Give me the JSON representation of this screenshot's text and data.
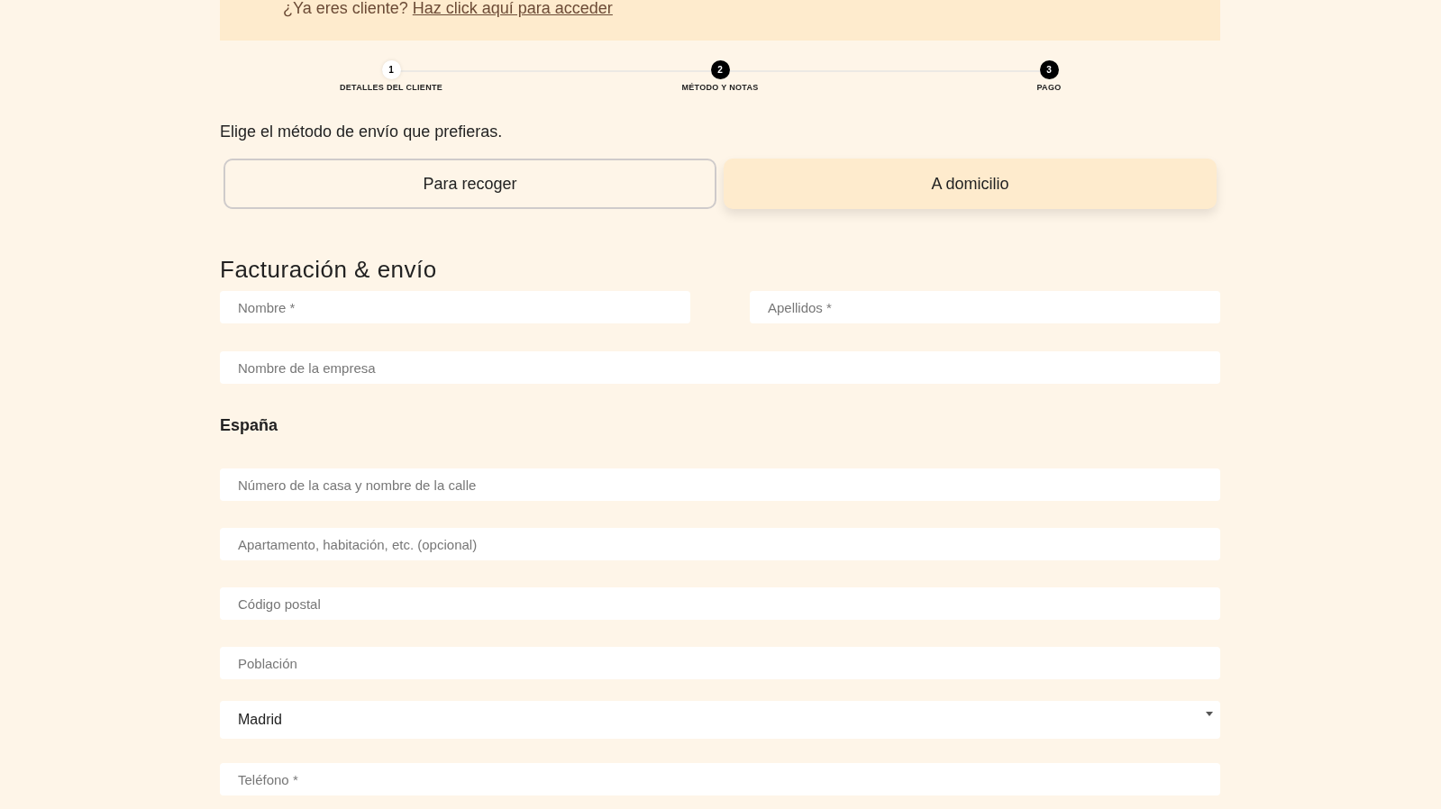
{
  "login_notice": {
    "text": "¿Ya eres cliente?",
    "link": "Haz click aquí para acceder"
  },
  "steps": [
    {
      "number": "1",
      "label": "DETALLES DEL CLIENTE",
      "selected": true
    },
    {
      "number": "2",
      "label": "MÉTODO Y NOTAS",
      "selected": false
    },
    {
      "number": "3",
      "label": "PAGO",
      "selected": false
    }
  ],
  "shipping_prompt": "Elige el método de envío que prefieras.",
  "shipping_options": [
    {
      "label": "Para recoger",
      "selected": false
    },
    {
      "label": "A domicilio",
      "selected": true
    }
  ],
  "section_title": "Facturación & envío",
  "name_fields": [
    {
      "placeholder": "Nombre *"
    },
    {
      "placeholder": "Apellidos *"
    }
  ],
  "company_field": {
    "placeholder": "Nombre de la empresa"
  },
  "country": "España",
  "address_fields": [
    {
      "placeholder": "Número de la casa y nombre de la calle"
    },
    {
      "placeholder": "Apartamento, habitación, etc. (opcional)"
    },
    {
      "placeholder": "Código postal"
    },
    {
      "placeholder": "Población"
    }
  ],
  "province_select": {
    "value": "Madrid"
  },
  "phone_field": {
    "placeholder": "Teléfono *"
  }
}
